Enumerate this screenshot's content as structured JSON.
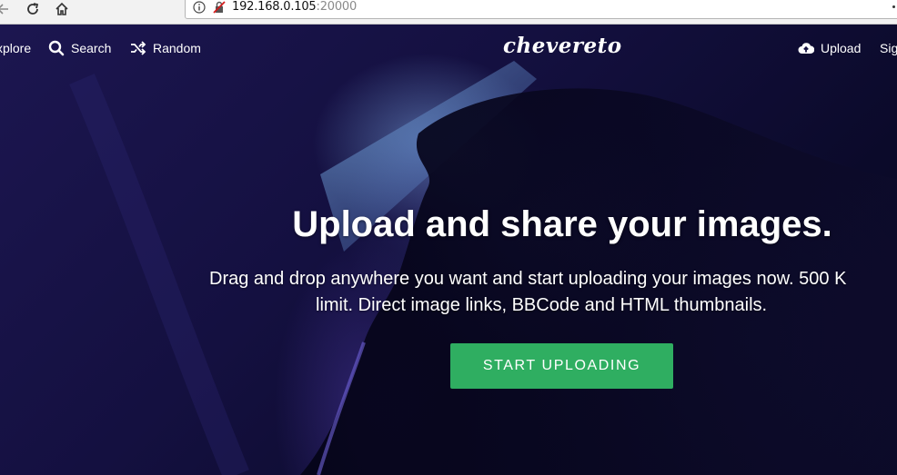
{
  "browser": {
    "url_host": "192.168.0.105",
    "url_port": ":20000",
    "icons": [
      "back-arrow-icon",
      "reload-icon",
      "home-icon",
      "info-icon",
      "insecure-lock-icon",
      "menu-dots-icon"
    ]
  },
  "nav": {
    "explore": "xplore",
    "search": "Search",
    "random": "Random",
    "upload": "Upload",
    "signin": "Sig",
    "logo": "chevereto"
  },
  "hero": {
    "headline": "Upload and share your images.",
    "subline_1": "Drag and drop anywhere you want and start uploading your images now. 500 K",
    "subline_2": "limit. Direct image links, BBCode and HTML thumbnails.",
    "cta": "START UPLOADING"
  },
  "colors": {
    "accent": "#2fae61",
    "hero_bg": "#141040"
  }
}
